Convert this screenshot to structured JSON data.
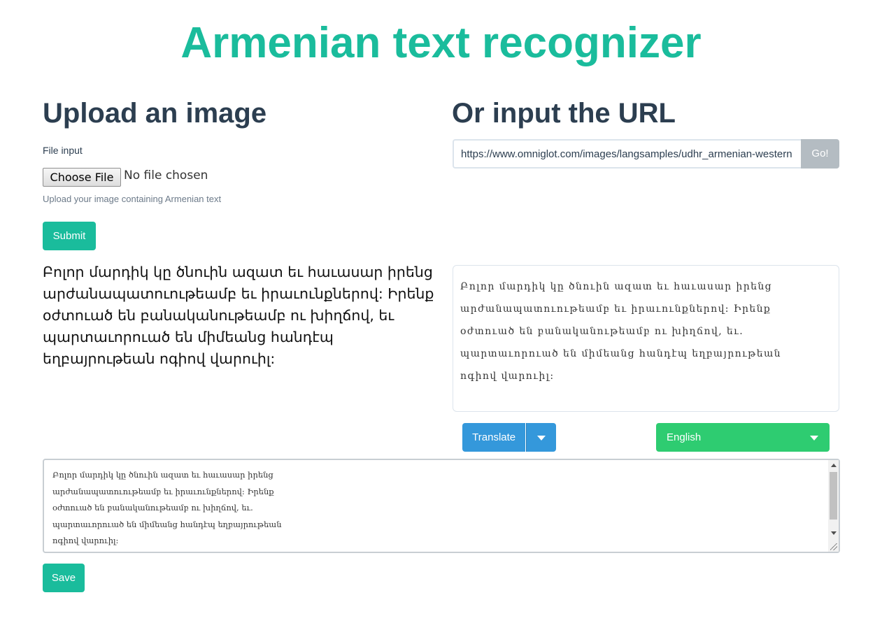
{
  "header": {
    "title": "Armenian text recognizer"
  },
  "upload": {
    "heading": "Upload an image",
    "file_label": "File input",
    "choose_button": "Choose File",
    "file_status": "No file chosen",
    "help_text": "Upload your image containing Armenian text",
    "submit_label": "Submit"
  },
  "url_section": {
    "heading": "Or input the URL",
    "url_value": "https://www.omniglot.com/images/langsamples/udhr_armenian-western",
    "go_label": "Go!"
  },
  "recognized_text": "Բոլոր մարդիկ կը ծնուին ազատ եւ հաւասար իրենց արժանապատուութեամբ եւ իրաւունքներով: Իրենք օժտուած են բանականութեամբ ու խիղճով, եւ պարտաւորուած են միմեանց հանդէպ եղբայրութեան ոգիով վարուիլ:",
  "source_image_lines": [
    "Բոլոր մարդիկ կը ծնուին ազատ եւ հաւասար իրենց",
    "արժանապատուութեամբ եւ իրաւունքներով: Իրենք",
    "օժտուած են բանականութեամբ ու խիղճով, եւ.",
    "պարտաւորուած են միմեանց հանդէպ եղբայրութեան",
    "ոգիով վարուիլ:"
  ],
  "controls": {
    "translate_label": "Translate",
    "language_selected": "English"
  },
  "output_lines": [
    "Բոլոր մարդիկ կը ծնուին ազատ եւ հաւասար իրենց",
    "արժանապատուութեամբ եւ իրաւունքներով: Իրենք",
    "օժտուած են բանականութեամբ ու խիղճով, եւ.",
    "պարտաւորուած են միմեանց հանդէպ եղբայրութեան",
    "ոգիով վարուիլ:"
  ],
  "save_label": "Save",
  "icons": {
    "translate_dropdown": "caret-down-icon",
    "language_dropdown": "caret-down-icon"
  },
  "colors": {
    "brand_teal": "#1abc9c",
    "heading": "#2c3e50",
    "translate_blue": "#3498db",
    "language_green": "#2ecc71",
    "go_gray": "#b4bcc2"
  }
}
